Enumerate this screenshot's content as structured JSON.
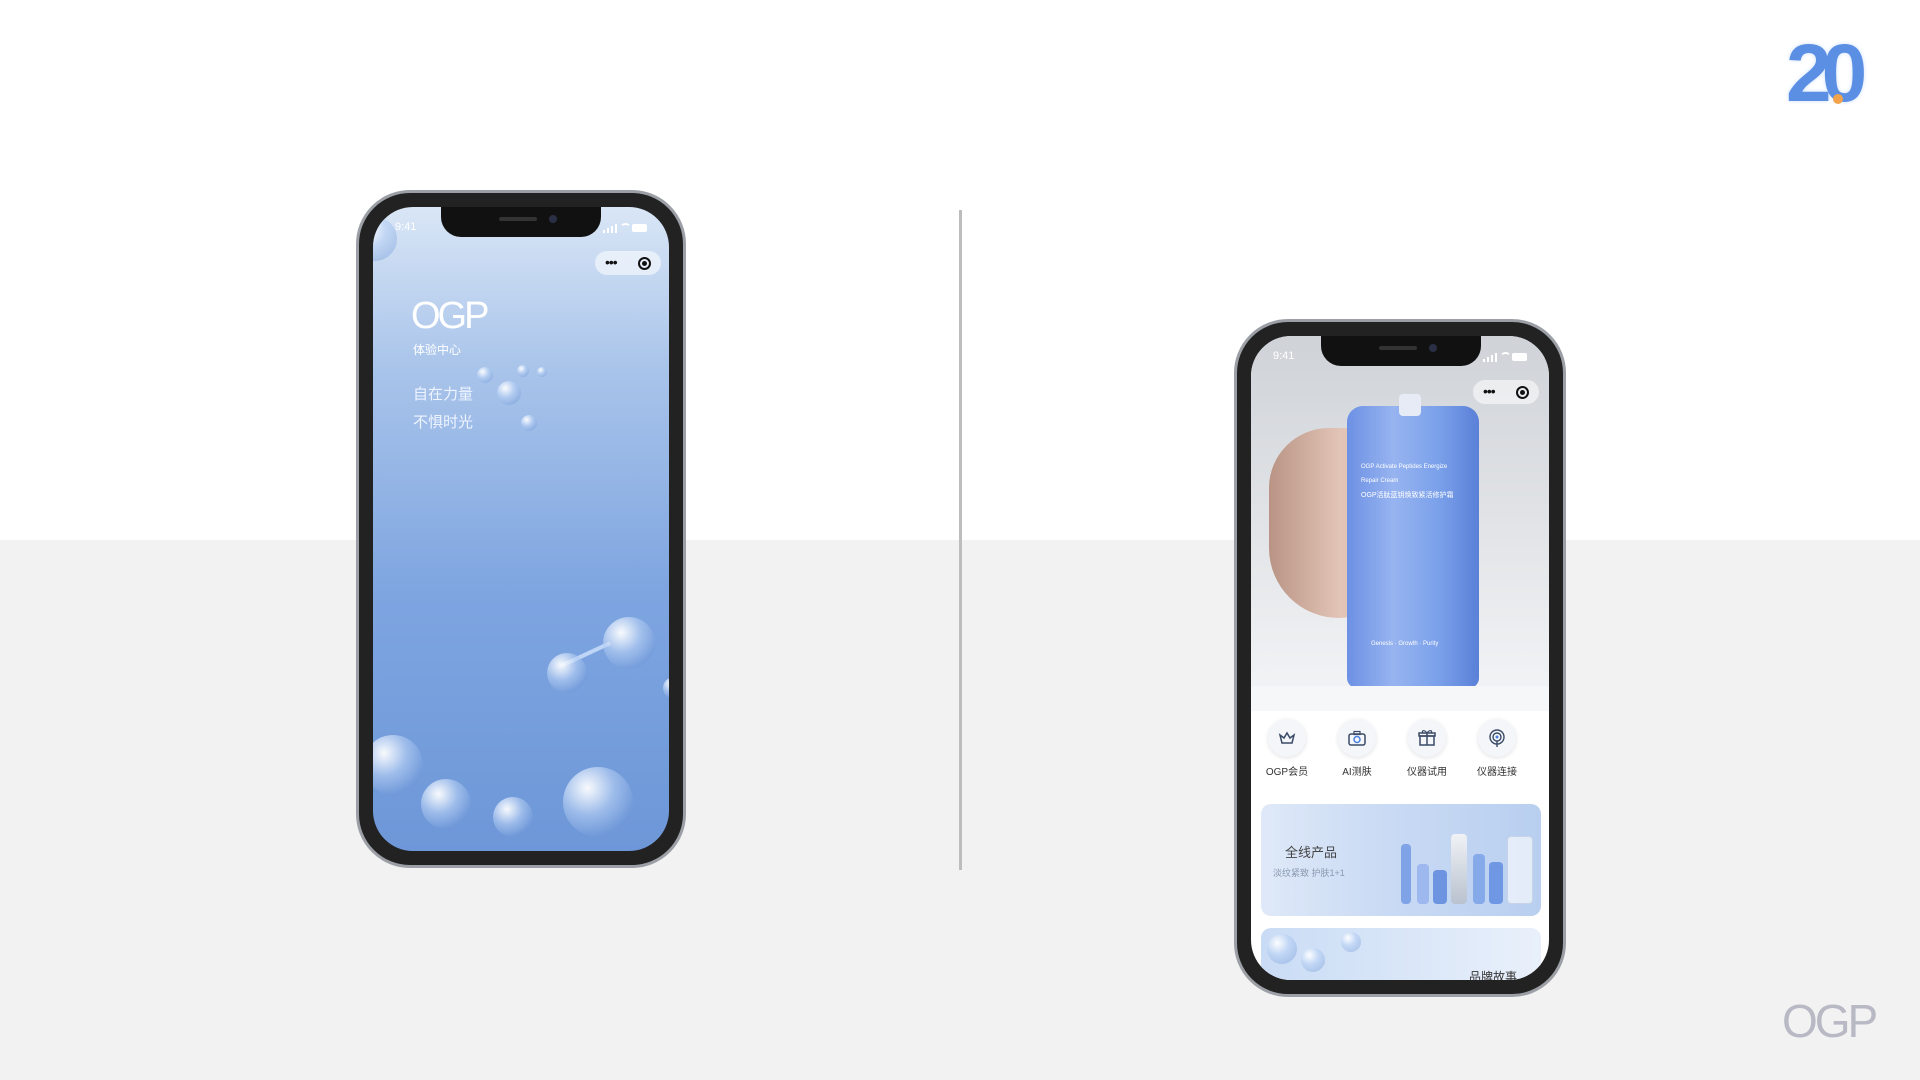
{
  "badge": {
    "number": "20"
  },
  "corner_logo": "OGP",
  "left_phone": {
    "time": "9:41",
    "logo": "OGP",
    "subtitle": "体验中心",
    "slogan_line1": "自在力量",
    "slogan_line2": "不惧时光",
    "capsule_more": "•••"
  },
  "right_phone": {
    "time": "9:41",
    "capsule_more": "•••",
    "bottle_text": {
      "line1": "OGP Activate Peptides Energize",
      "line2": "Repair Cream",
      "line3": "OGP活肽蓝钥焕致紧活修护霜",
      "line4": "Genesis · Growth · Purity"
    },
    "quick_actions": [
      {
        "label": "OGP会员",
        "icon": "crown-icon"
      },
      {
        "label": "AI测肤",
        "icon": "camera-icon"
      },
      {
        "label": "仪器试用",
        "icon": "gift-icon"
      },
      {
        "label": "仪器连接",
        "icon": "fingerprint-icon"
      }
    ],
    "card_products": {
      "title": "全线产品",
      "subtitle": "淡纹紧致 护肤1+1"
    },
    "card_brand": {
      "title": "品牌故事"
    }
  }
}
